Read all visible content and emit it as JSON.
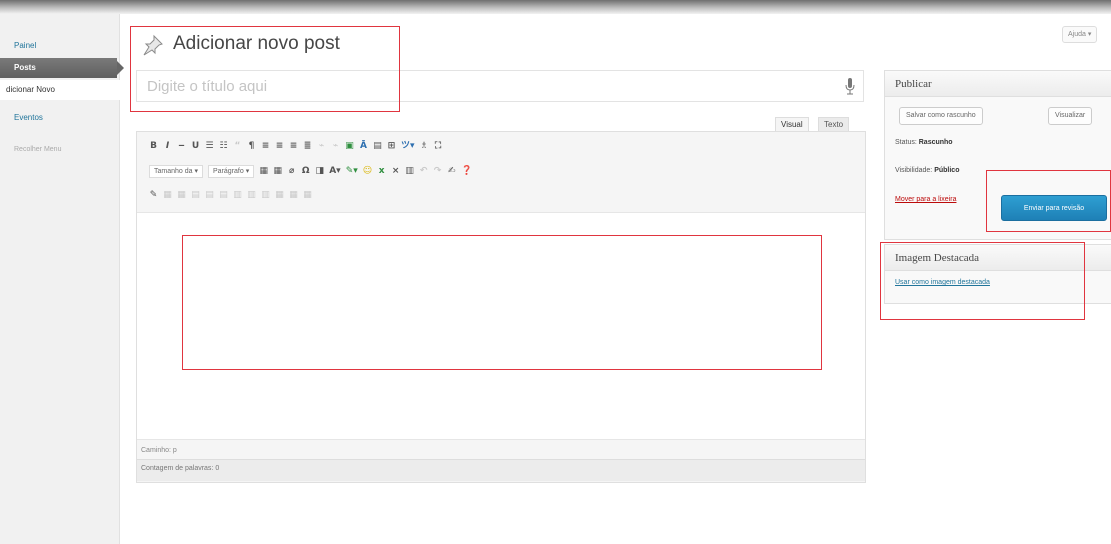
{
  "sidebar": {
    "items": [
      {
        "label": "Painel"
      },
      {
        "label": "Posts"
      },
      {
        "label": "dicionar Novo"
      },
      {
        "label": "Eventos"
      },
      {
        "label": "Recolher Menu"
      }
    ]
  },
  "header": {
    "title": "Adicionar novo post",
    "help_label": "Ajuda ▾"
  },
  "title_input": {
    "placeholder": "Digite o título aqui"
  },
  "editor": {
    "tabs": [
      "Visual",
      "Texto"
    ],
    "format_select": "Tamanho da",
    "paragraph_select": "Parágrafo",
    "path_label": "Caminho: p",
    "word_count": "Contagem de palavras: 0"
  },
  "publish": {
    "heading": "Publicar",
    "save_draft": "Salvar como rascunho",
    "preview": "Visualizar",
    "status_label": "Status:",
    "status_value": "Rascunho",
    "visibility_label": "Visibilidade:",
    "visibility_value": "Público",
    "trash_link": "Mover para a lixeira",
    "submit": "Enviar para revisão"
  },
  "featured_image": {
    "heading": "Imagem Destacada",
    "link": "Usar como imagem destacada"
  },
  "colors": {
    "highlight": "#e0353f",
    "primary": "#1e80b6",
    "link": "#21759b"
  }
}
